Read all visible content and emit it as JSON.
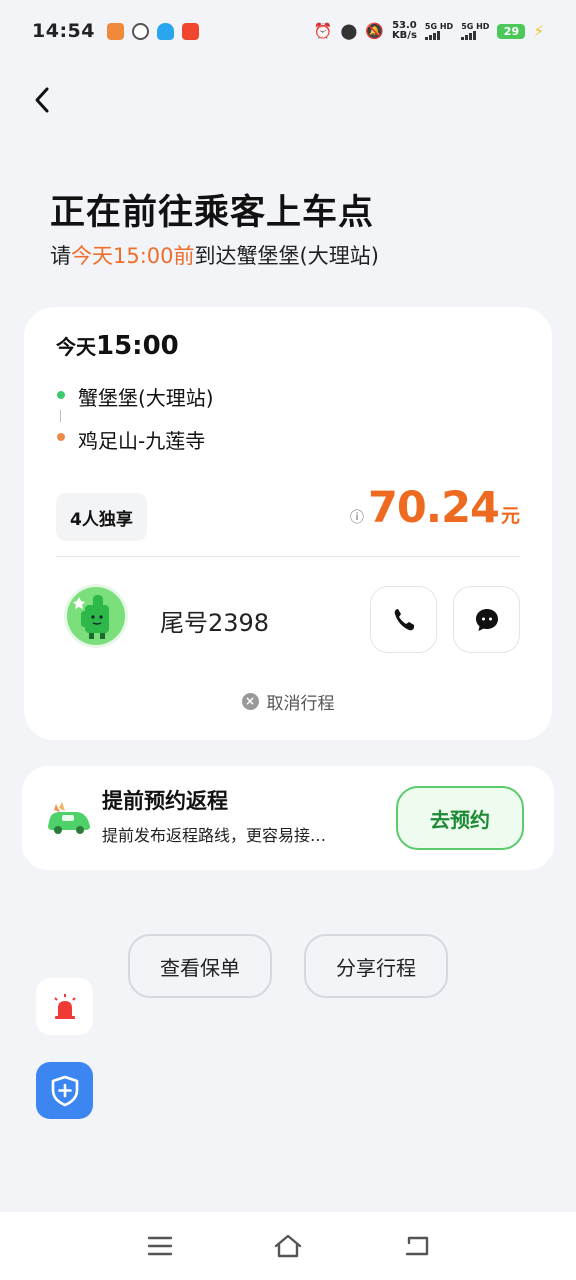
{
  "status_bar": {
    "time": "14:54",
    "net_speed_value": "53.0",
    "net_speed_unit": "KB/s",
    "signal1_label": "5G HD",
    "signal2_label": "5G HD",
    "battery": "29"
  },
  "header": {
    "title": "正在前往乘客上车点",
    "subtitle_prefix": "请",
    "subtitle_highlight": "今天15:00前",
    "subtitle_suffix": "到达蟹堡堡(大理站)"
  },
  "trip": {
    "day": "今天",
    "time": "15:00",
    "pickup": "蟹堡堡(大理站)",
    "dropoff": "鸡足山-九莲寺",
    "seat_type": "4人独享",
    "price": "70.24",
    "price_unit": "元",
    "plate_tail": "尾号2398",
    "cancel_label": "取消行程"
  },
  "return_trip": {
    "title": "提前预约返程",
    "description": "提前发布返程路线，更容易接…",
    "button_label": "去预约"
  },
  "actions": {
    "view_policy": "查看保单",
    "share_trip": "分享行程"
  },
  "colors": {
    "accent_orange": "#ee6a20",
    "accent_green": "#5ccb6d",
    "pickup_dot": "#3ec96f",
    "dropoff_dot": "#ee8a4a",
    "background": "#f2f4f8"
  },
  "icons": {
    "back": "chevron-left-icon",
    "phone": "phone-icon",
    "message": "chat-bubble-icon",
    "alarm": "siren-icon",
    "safety": "shield-plus-icon",
    "nav_menu": "menu-icon",
    "nav_home": "home-icon",
    "nav_back": "back-icon"
  }
}
